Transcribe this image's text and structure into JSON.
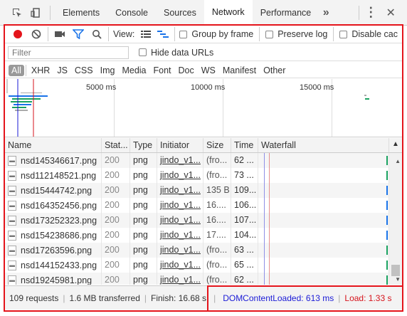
{
  "tabs": [
    {
      "label": "Elements",
      "active": false
    },
    {
      "label": "Console",
      "active": false
    },
    {
      "label": "Sources",
      "active": false
    },
    {
      "label": "Network",
      "active": true
    },
    {
      "label": "Performance",
      "active": false
    }
  ],
  "toolbar": {
    "view_label": "View:",
    "group_by_frame": "Group by frame",
    "preserve_log": "Preserve log",
    "disable_cache": "Disable cac"
  },
  "filter": {
    "placeholder": "Filter",
    "hide_data_urls": "Hide data URLs"
  },
  "types": [
    "All",
    "XHR",
    "JS",
    "CSS",
    "Img",
    "Media",
    "Font",
    "Doc",
    "WS",
    "Manifest",
    "Other"
  ],
  "overview": {
    "ticks": [
      "5000 ms",
      "10000 ms",
      "15000 ms"
    ]
  },
  "columns": {
    "name": "Name",
    "status": "Stat...",
    "type": "Type",
    "initiator": "Initiator",
    "size": "Size",
    "time": "Time",
    "waterfall": "Waterfall"
  },
  "rows": [
    {
      "name": "nsd145346617.png",
      "status": "200",
      "type": "png",
      "initiator": "jindo_v1...",
      "size": "(fro...",
      "time": "62 ...",
      "bar_color": "#1aa260"
    },
    {
      "name": "nsd112148521.png",
      "status": "200",
      "type": "png",
      "initiator": "jindo_v1...",
      "size": "(fro...",
      "time": "73 ...",
      "bar_color": "#1aa260"
    },
    {
      "name": "nsd15444742.png",
      "status": "200",
      "type": "png",
      "initiator": "jindo_v1...",
      "size": "135 B",
      "time": "109...",
      "bar_color": "#1a73e8"
    },
    {
      "name": "nsd164352456.png",
      "status": "200",
      "type": "png",
      "initiator": "jindo_v1...",
      "size": "16....",
      "time": "106...",
      "bar_color": "#1a73e8"
    },
    {
      "name": "nsd173252323.png",
      "status": "200",
      "type": "png",
      "initiator": "jindo_v1...",
      "size": "16....",
      "time": "107...",
      "bar_color": "#1a73e8"
    },
    {
      "name": "nsd154238686.png",
      "status": "200",
      "type": "png",
      "initiator": "jindo_v1...",
      "size": "17....",
      "time": "104...",
      "bar_color": "#1a73e8"
    },
    {
      "name": "nsd17263596.png",
      "status": "200",
      "type": "png",
      "initiator": "jindo_v1...",
      "size": "(fro...",
      "time": "63 ...",
      "bar_color": "#1aa260"
    },
    {
      "name": "nsd144152433.png",
      "status": "200",
      "type": "png",
      "initiator": "jindo_v1...",
      "size": "(fro...",
      "time": "65 ...",
      "bar_color": "#1aa260"
    },
    {
      "name": "nsd19245981.png",
      "status": "200",
      "type": "png",
      "initiator": "jindo_v1...",
      "size": "(fro...",
      "time": "62 ...",
      "bar_color": "#1aa260"
    }
  ],
  "status": {
    "requests": "109 requests",
    "transferred": "1.6 MB transferred",
    "finish": "Finish: 16.68 s",
    "dom_content_loaded": "DOMContentLoaded: 613 ms",
    "load": "Load: 1.33 s"
  },
  "colors": {
    "accent": "#1a73e8",
    "record": "#e4141b",
    "dcl": "#1a1ad6",
    "load": "#d6131b",
    "highlight_box": "#e4141b"
  }
}
